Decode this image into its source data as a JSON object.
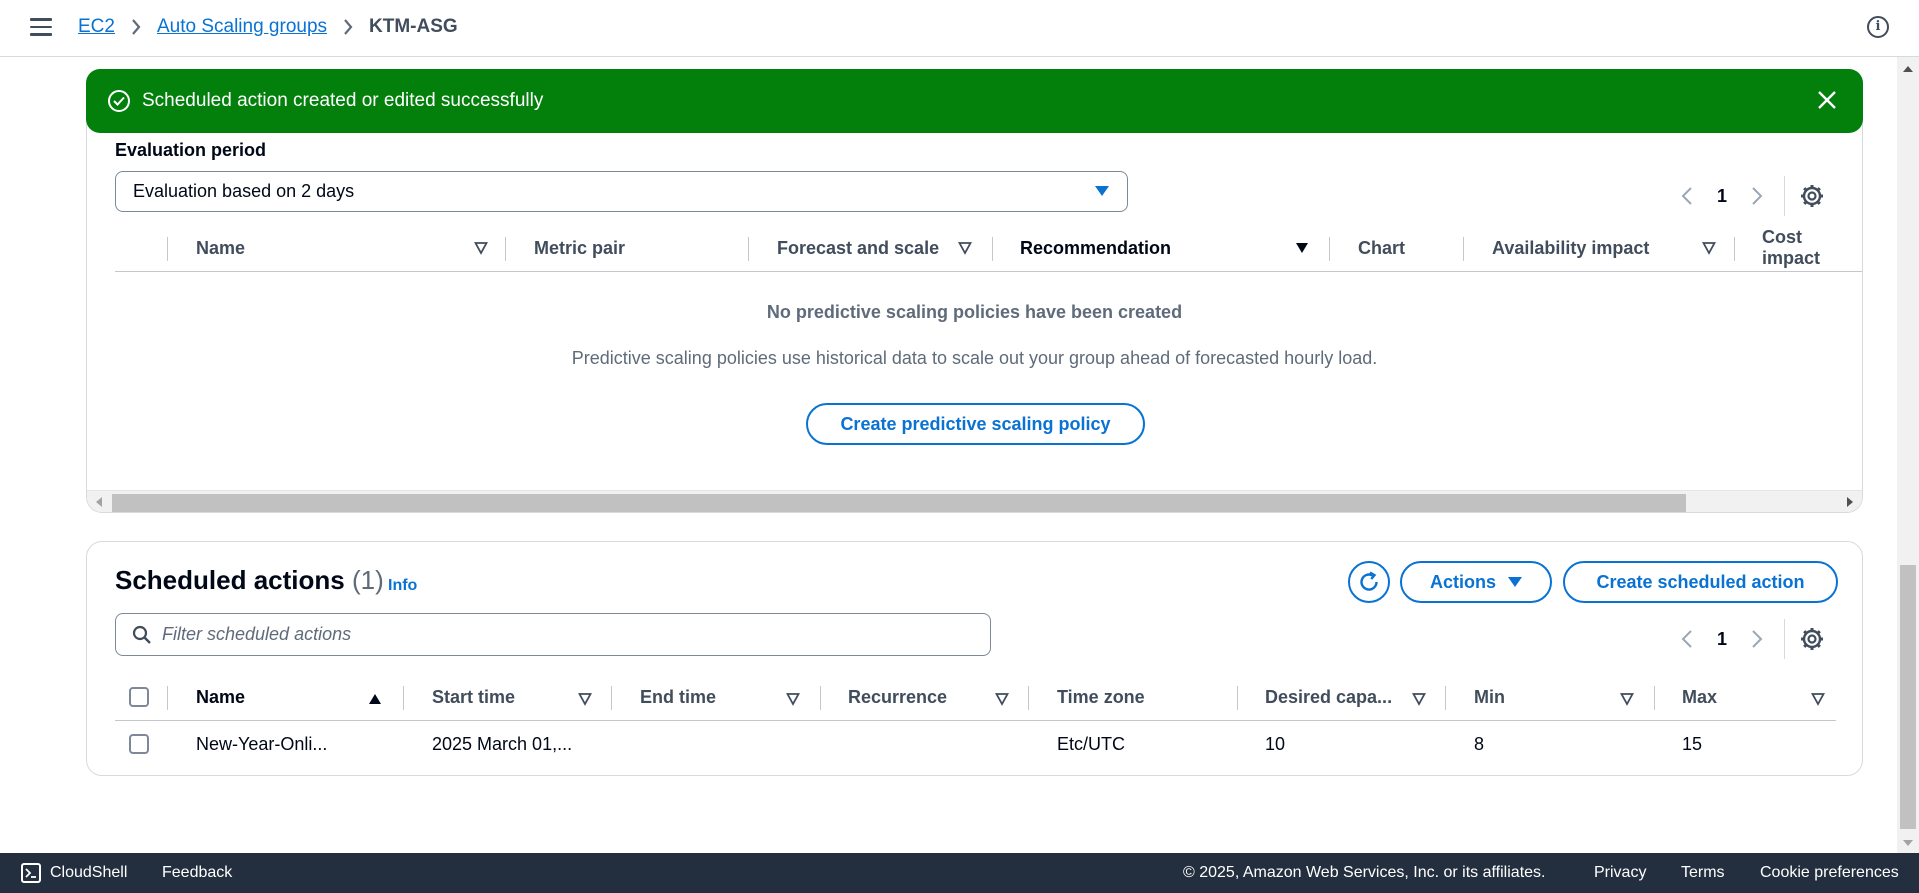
{
  "breadcrumb": {
    "items": [
      "EC2",
      "Auto Scaling groups"
    ],
    "current": "KTM-ASG"
  },
  "flash": {
    "message": "Scheduled action created or edited successfully",
    "color": "#037f0c"
  },
  "predictive": {
    "eval_label": "Evaluation period",
    "eval_value": "Evaluation based on 2 days",
    "page": "1",
    "columns": [
      "Name",
      "Metric pair",
      "Forecast and scale",
      "Recommendation",
      "Chart",
      "Availability impact",
      "Cost impact"
    ],
    "empty_title": "No predictive scaling policies have been created",
    "empty_desc": "Predictive scaling policies use historical data to scale out your group ahead of forecasted hourly load.",
    "create_button": "Create predictive scaling policy"
  },
  "scheduled": {
    "title": "Scheduled actions",
    "count": "(1)",
    "info_link": "Info",
    "actions_button": "Actions",
    "create_button": "Create scheduled action",
    "filter_placeholder": "Filter scheduled actions",
    "page": "1",
    "columns": [
      "Name",
      "Start time",
      "End time",
      "Recurrence",
      "Time zone",
      "Desired capa...",
      "Min",
      "Max"
    ],
    "rows": [
      {
        "name": "New-Year-Onli...",
        "start_time": "2025 March 01,...",
        "end_time": "",
        "recurrence": "",
        "time_zone": "Etc/UTC",
        "desired": "10",
        "min": "8",
        "max": "15"
      }
    ]
  },
  "footer": {
    "cloudshell": "CloudShell",
    "feedback": "Feedback",
    "copyright": "© 2025, Amazon Web Services, Inc. or its affiliates.",
    "privacy": "Privacy",
    "terms": "Terms",
    "cookie": "Cookie preferences"
  },
  "colors": {
    "link": "#0972d3",
    "footer_bg": "#232f3e"
  }
}
